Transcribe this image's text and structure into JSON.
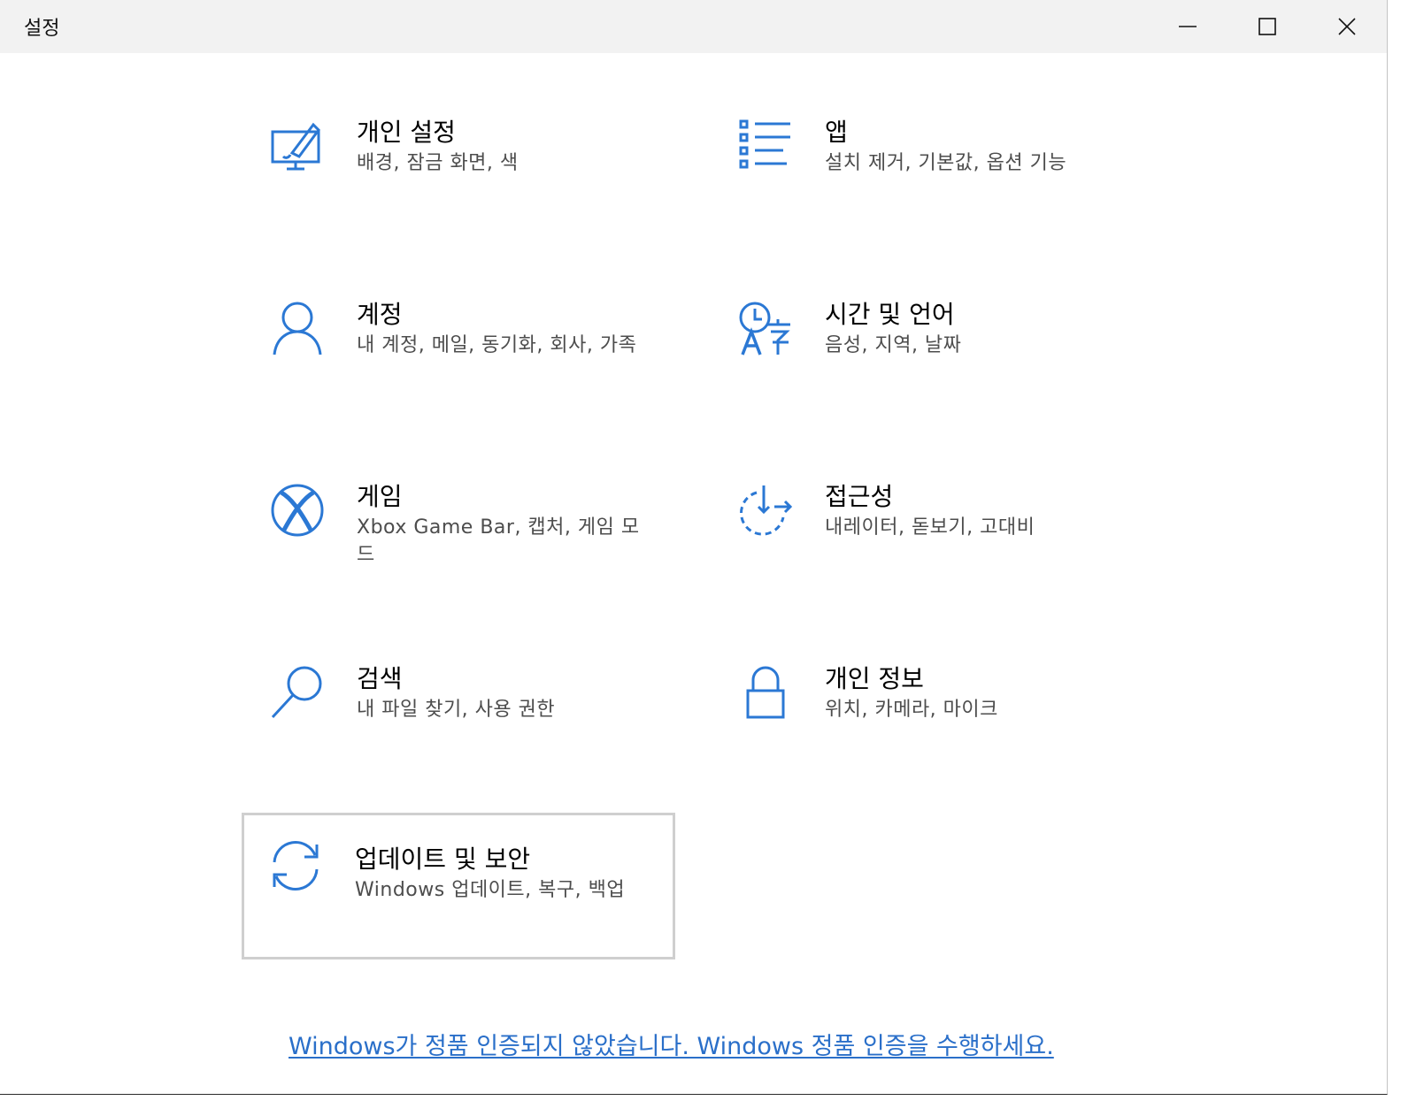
{
  "window": {
    "title": "설정",
    "controls": {
      "minimize": "minimize",
      "maximize": "maximize",
      "close": "close"
    }
  },
  "accent_color": "#2b78d4",
  "tiles": [
    {
      "icon": "personalization-icon",
      "title": "개인 설정",
      "desc": "배경, 잠금 화면, 색"
    },
    {
      "icon": "apps-icon",
      "title": "앱",
      "desc": "설치 제거, 기본값, 옵션 기능"
    },
    {
      "icon": "person-icon",
      "title": "계정",
      "desc": "내 계정, 메일, 동기화, 회사, 가족"
    },
    {
      "icon": "time-language-icon",
      "title": "시간 및 언어",
      "desc": "음성, 지역, 날짜"
    },
    {
      "icon": "xbox-icon",
      "title": "게임",
      "desc": "Xbox Game Bar, 캡처, 게임 모드"
    },
    {
      "icon": "accessibility-icon",
      "title": "접근성",
      "desc": "내레이터, 돋보기, 고대비"
    },
    {
      "icon": "search-icon",
      "title": "검색",
      "desc": "내 파일 찾기, 사용 권한"
    },
    {
      "icon": "lock-icon",
      "title": "개인 정보",
      "desc": "위치, 카메라, 마이크"
    },
    {
      "icon": "sync-icon",
      "title": "업데이트 및 보안",
      "desc": "Windows 업데이트, 복구, 백업",
      "selected": true
    }
  ],
  "activation_link": "Windows가 정품 인증되지 않았습니다. Windows 정품 인증을 수행하세요."
}
